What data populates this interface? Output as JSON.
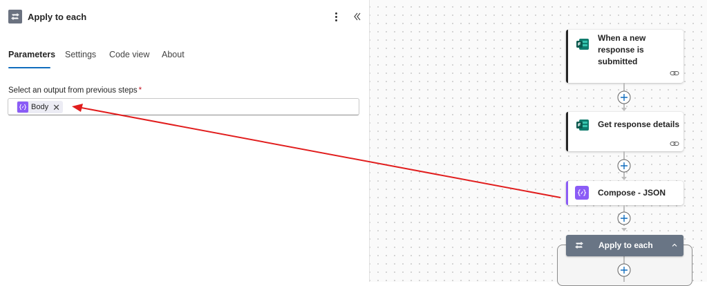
{
  "panel": {
    "title": "Apply to each",
    "icon": "loop-icon",
    "tabs": [
      {
        "label": "Parameters",
        "active": true
      },
      {
        "label": "Settings",
        "active": false
      },
      {
        "label": "Code view",
        "active": false
      },
      {
        "label": "About",
        "active": false
      }
    ],
    "field_label": "Select an output from previous steps",
    "required_mark": "*",
    "token": {
      "label": "Body",
      "icon": "expression-icon",
      "remove": "✕"
    }
  },
  "canvas": {
    "cards": [
      {
        "title": "When a new response is submitted",
        "icon": "forms-icon"
      },
      {
        "title": "Get response details",
        "icon": "forms-icon"
      },
      {
        "title": "Compose - JSON",
        "icon": "compose-icon"
      }
    ],
    "scope": {
      "title": "Apply to each",
      "icon": "loop-icon"
    }
  },
  "colors": {
    "accent_blue": "#0f6cbd",
    "compose_purple": "#8b5cf6",
    "scope_header": "#697585",
    "annotation_red": "#e11d1d"
  }
}
